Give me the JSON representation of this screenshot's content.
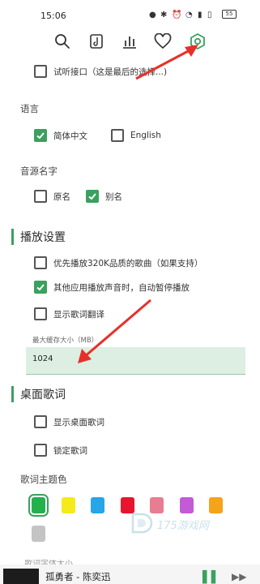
{
  "status": {
    "time": "15:06",
    "battery": "55"
  },
  "toolbar": {
    "icons": [
      "search-icon",
      "lyrics-icon",
      "chart-icon",
      "heart-icon",
      "settings-icon"
    ]
  },
  "top_option": {
    "label": "试听接口（这是最后的选择...)",
    "checked": false
  },
  "language": {
    "label": "语言",
    "options": [
      {
        "label": "简体中文",
        "checked": true
      },
      {
        "label": "English",
        "checked": false
      }
    ]
  },
  "source_name": {
    "label": "音源名字",
    "options": [
      {
        "label": "原名",
        "checked": false
      },
      {
        "label": "别名",
        "checked": true
      }
    ]
  },
  "playback": {
    "title": "播放设置",
    "options": [
      {
        "label": "优先播放320K品质的歌曲（如果支持）",
        "checked": false
      },
      {
        "label": "其他应用播放声音时，自动暂停播放",
        "checked": true
      },
      {
        "label": "显示歌词翻译",
        "checked": false
      }
    ],
    "cache_label": "最大缓存大小（MB）",
    "cache_value": "1024"
  },
  "desktop_lyrics": {
    "title": "桌面歌词",
    "options": [
      {
        "label": "显示桌面歌词",
        "checked": false
      },
      {
        "label": "锁定歌词",
        "checked": false
      }
    ],
    "theme_label": "歌词主题色",
    "colors": [
      "#22b14c",
      "#f5ea1a",
      "#26a6e8",
      "#e6162d",
      "#e87c90",
      "#c45ad6",
      "#f5a31a",
      "#c4c4c4"
    ],
    "selected_color_index": 0
  },
  "cut_off_label": "歌词字体大小",
  "watermark": "175游戏网",
  "player": {
    "song": "孤勇者 - 陈奕迅"
  },
  "accent": "#3aa15e",
  "arrow_color": "#e8302a"
}
